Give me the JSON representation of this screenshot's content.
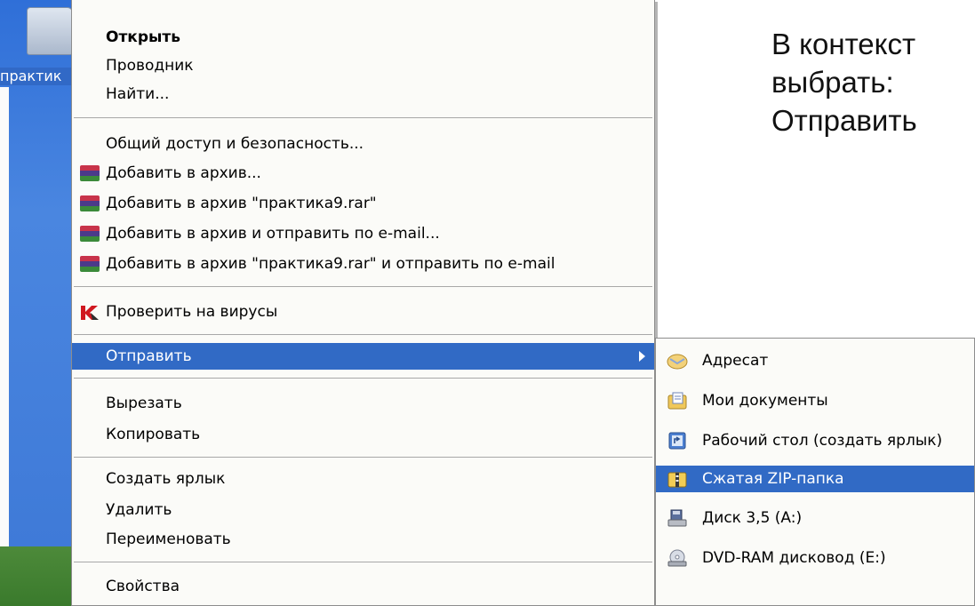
{
  "desktop": {
    "folder_label": "практик"
  },
  "menu": {
    "items": [
      {
        "label": "Открыть"
      },
      {
        "label": "Проводник"
      },
      {
        "label": "Найти..."
      },
      {
        "label": "Общий доступ и безопасность..."
      },
      {
        "label": "Добавить в архив..."
      },
      {
        "label": "Добавить в архив \"практика9.rar\""
      },
      {
        "label": "Добавить в архив и отправить по e-mail..."
      },
      {
        "label": "Добавить в архив \"практика9.rar\" и отправить по e-mail"
      },
      {
        "label": "Проверить на вирусы"
      },
      {
        "label": "Отправить"
      },
      {
        "label": "Вырезать"
      },
      {
        "label": "Копировать"
      },
      {
        "label": "Создать ярлык"
      },
      {
        "label": "Удалить"
      },
      {
        "label": "Переименовать"
      },
      {
        "label": "Свойства"
      }
    ]
  },
  "submenu": {
    "items": [
      {
        "label": "Адресат",
        "icon": "mail-recipient-icon"
      },
      {
        "label": "Мои документы",
        "icon": "my-documents-icon"
      },
      {
        "label": "Рабочий стол (создать ярлык)",
        "icon": "desktop-shortcut-icon"
      },
      {
        "label": "Сжатая ZIP-папка",
        "icon": "zip-folder-icon"
      },
      {
        "label": "Диск 3,5 (A:)",
        "icon": "floppy-drive-icon"
      },
      {
        "label": "DVD-RAM дисковод (E:)",
        "icon": "dvd-drive-icon"
      }
    ]
  },
  "note": {
    "line1": "В контекст",
    "line2": "выбрать:",
    "line3": "Отправить"
  },
  "colors": {
    "selection": "#316ac5",
    "menu_bg": "#fbfbf8"
  }
}
